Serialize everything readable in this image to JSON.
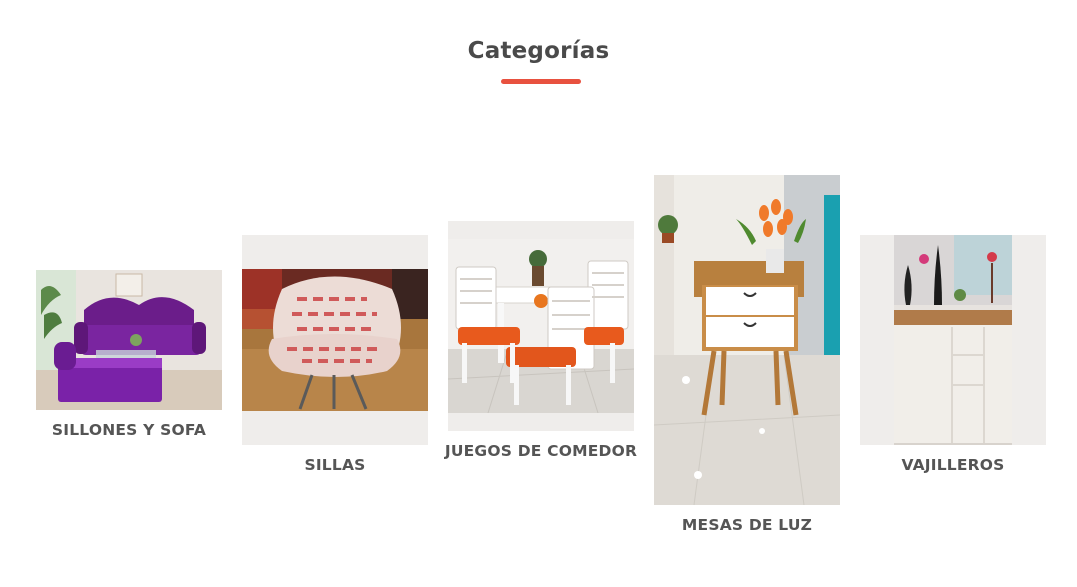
{
  "section": {
    "title": "Categorías",
    "accent_color": "#e8513f"
  },
  "categories": [
    {
      "label": "SILLONES Y SOFA",
      "image": "purple-tufted-sofa-and-ottoman-photo"
    },
    {
      "label": "SILLAS",
      "image": "patterned-lounge-chair-photo"
    },
    {
      "label": "JUEGOS DE COMEDOR",
      "image": "white-dining-set-orange-seats-photo"
    },
    {
      "label": "MESAS DE LUZ",
      "image": "wood-nightstand-white-drawers-photo"
    },
    {
      "label": "VAJILLEROS",
      "image": "white-sideboard-cabinet-photo"
    }
  ]
}
